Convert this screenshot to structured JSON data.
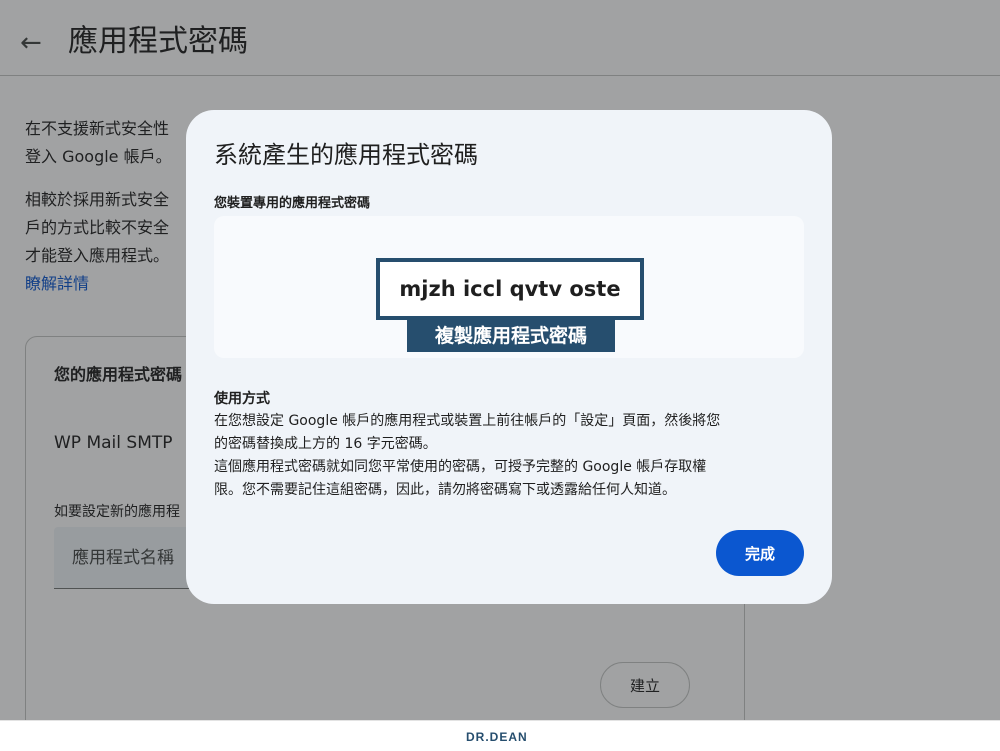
{
  "page": {
    "title": "應用程式密碼",
    "intro_line1": "在不支援新式安全性",
    "intro_line2": "登入 Google 帳戶。",
    "desc_line1": "相較於採用新式安全",
    "desc_line2": "戶的方式比較不安全",
    "desc_line3": "才能登入應用程式。",
    "learn_more": "瞭解詳情"
  },
  "card": {
    "heading": "您的應用程式密碼",
    "app_entry": "WP Mail SMTP",
    "create_hint": "如要設定新的應用程",
    "name_placeholder": "應用程式名稱",
    "create_label": "建立"
  },
  "dialog": {
    "title": "系統產生的應用程式密碼",
    "password_label": "您裝置專用的應用程式密碼",
    "password": "mjzh iccl qvtv oste",
    "copy_label": "複製應用程式密碼",
    "usage_title": "使用方式",
    "usage_line1": "在您想設定 Google 帳戶的應用程式或裝置上前往帳戶的「設定」頁面，然後將您",
    "usage_line2": "的密碼替換成上方的 16 字元密碼。",
    "usage_line3": "這個應用程式密碼就如同您平常使用的密碼，可授予完整的 Google 帳戶存取權",
    "usage_line4": "限。您不需要記住這組密碼，因此，請勿將密碼寫下或透露給任何人知道。",
    "done_label": "完成"
  },
  "footer": {
    "brand": "DR.DEAN"
  },
  "colors": {
    "accent": "#0b57d0",
    "highlight": "#264e6e",
    "dialog_bg": "#f0f4f9"
  }
}
